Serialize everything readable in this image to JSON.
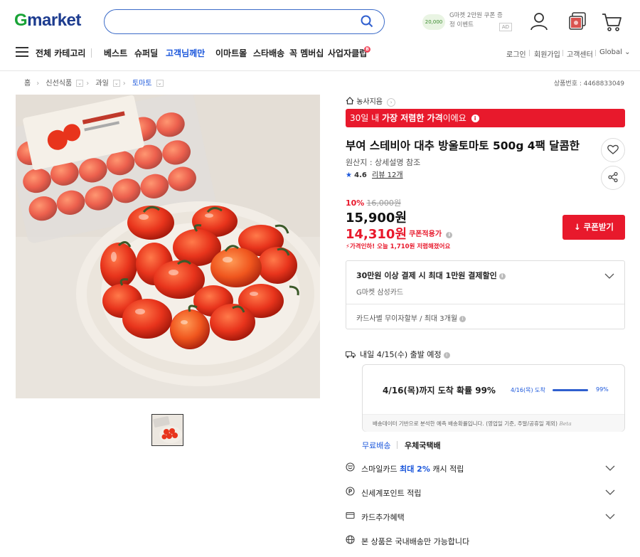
{
  "header": {
    "logo_g": "G",
    "logo_rest": "market",
    "search_placeholder": "",
    "ad_coupon": "20,000",
    "ad_text": "G마켓 2만원 쿠폰 증정 이벤트",
    "ad_badge": "AD"
  },
  "nav": {
    "all_categories": "전체 카테고리",
    "items": [
      "베스트",
      "슈퍼딜",
      "고객님께만",
      "이마트몰",
      "스타배송",
      "꼭 멤버십",
      "사업자클럽"
    ],
    "badge": "B",
    "util": [
      "로그인",
      "회원가입",
      "고객센터",
      "Global"
    ]
  },
  "breadcrumb": {
    "items": [
      "홈",
      "신선식품",
      "과일",
      "토마토"
    ],
    "product_no": "상품번호 : 4468833049"
  },
  "product": {
    "store": "농사지음",
    "lowest_banner_pre": "30일 내 ",
    "lowest_banner_bold": "가장 저렴한 가격",
    "lowest_banner_post": "이에요",
    "title": "부여 스테비아 대추 방울토마토 500g 4팩 달콤한",
    "origin": "원산지 : 상세설명 참조",
    "rating": "4.6",
    "review": "리뷰 12개",
    "discount_pct": "10%",
    "original_price": "16,000원",
    "sale_price": "15,900원",
    "coupon_price": "14,310원",
    "coupon_label": "쿠폰적용가",
    "price_drop": "가격인하! 오늘 1,710원 저렴해졌어요",
    "coupon_button": "쿠폰받기"
  },
  "card": {
    "title": "30만원 이상 결제 시 최대 1만원 결제할인",
    "sub": "G마켓 삼성카드",
    "installment": "카드사별 무이자할부 / 최대 3개월"
  },
  "shipping": {
    "line": "내일 4/15(수) 출발 예정",
    "prob": "4/16(목)까지 도착 확률 99%",
    "date_small": "4/16(목) 도착",
    "pct": "99%",
    "note": "배송데이터 기반으로 분석한 예측 배송확률입니다. (영업일 기준, 주말/공휴일 제외)",
    "beta": "Beta",
    "free": "무료배송",
    "post": "우체국택배"
  },
  "benefits": {
    "smile_pre": "스마일카드 ",
    "smile_blue": "최대 2%",
    "smile_post": " 캐시 적립",
    "shinsegae": "신세계포인트 적립",
    "card_extra": "카드추가혜택",
    "domestic": "본 상품은 국내배송만 가능합니다"
  },
  "colors": {
    "accent_red": "#e8192c",
    "accent_blue": "#1a56db",
    "logo_green": "#19a337"
  }
}
